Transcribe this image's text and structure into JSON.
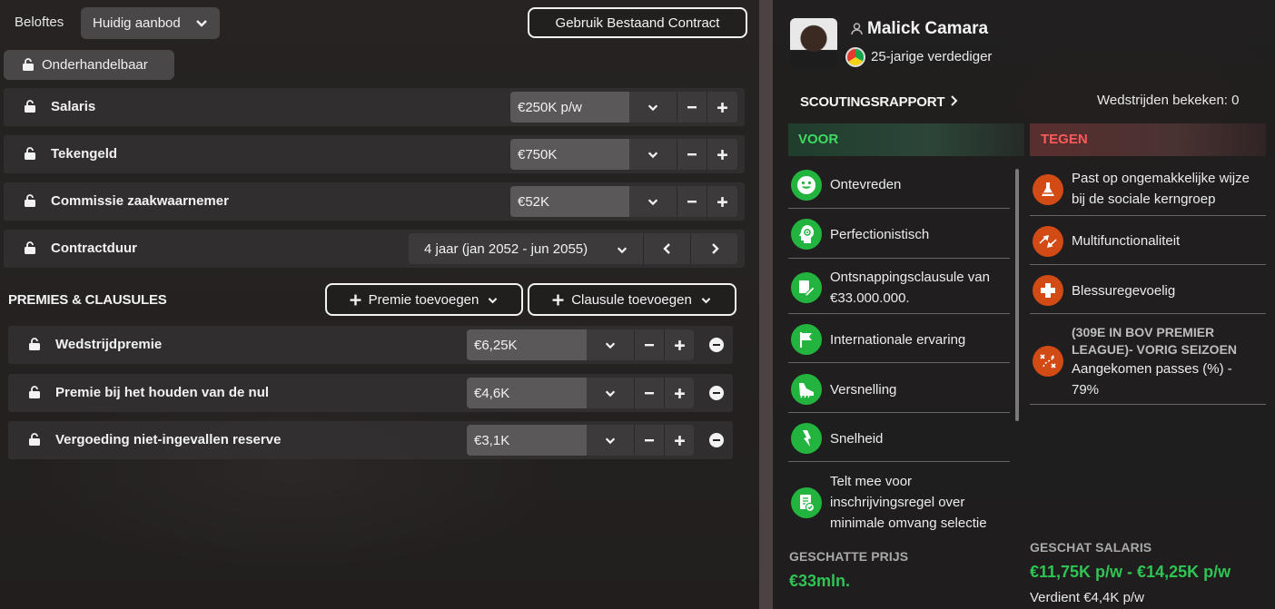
{
  "top": {
    "beloftes_label": "Beloftes",
    "offer_dropdown": "Huidig aanbod",
    "use_contract_button": "Gebruik Bestaand Contract",
    "negotiable_button": "Onderhandelbaar"
  },
  "terms": [
    {
      "label": "Salaris",
      "value": "€250K p/w"
    },
    {
      "label": "Tekengeld",
      "value": "€750K"
    },
    {
      "label": "Commissie zaakwaarnemer",
      "value": "€52K"
    },
    {
      "label": "Contractduur",
      "value": "4 jaar (jan 2052 - jun 2055)"
    }
  ],
  "bonuses": {
    "title": "PREMIES & CLAUSULES",
    "add_bonus": "Premie toevoegen",
    "add_clause": "Clausule toevoegen",
    "items": [
      {
        "label": "Wedstrijdpremie",
        "value": "€6,25K"
      },
      {
        "label": "Premie bij het houden van de nul",
        "value": "€4,6K"
      },
      {
        "label": "Vergoeding niet-ingevallen reserve",
        "value": "€3,1K"
      }
    ]
  },
  "player": {
    "name": "Malick Camara",
    "description": "25-jarige verdediger"
  },
  "scouting": {
    "link": "SCOUTINGSRAPPORT",
    "matches_seen": "Wedstrijden bekeken: 0",
    "pro_title": "VOOR",
    "con_title": "TEGEN",
    "pros": [
      {
        "icon": "smiley-icon",
        "lines": [
          "Ontevreden"
        ]
      },
      {
        "icon": "head-target-icon",
        "lines": [
          "Perfectionistisch"
        ]
      },
      {
        "icon": "contract-pen-icon",
        "lines": [
          "Ontsnappingsclausule van",
          "€33.000.000."
        ]
      },
      {
        "icon": "flag-icon",
        "lines": [
          "Internationale ervaring"
        ]
      },
      {
        "icon": "boot-icon",
        "lines": [
          "Versnelling"
        ]
      },
      {
        "icon": "lightning-icon",
        "lines": [
          "Snelheid"
        ]
      },
      {
        "icon": "checklist-icon",
        "lines": [
          "Telt mee voor",
          "inschrijvingsregel over",
          "minimale omvang selectie"
        ]
      }
    ],
    "cons": [
      {
        "icon": "flask-icon",
        "lines": [
          "Past op ongemakkelijke wijze",
          "bij de sociale kerngroep"
        ]
      },
      {
        "icon": "swap-arrows-icon",
        "lines": [
          "Multifunctionaliteit"
        ]
      },
      {
        "icon": "medical-cross-icon",
        "lines": [
          "Blessuregevoelig"
        ]
      },
      {
        "icon": "tactics-icon",
        "heading": [
          "(309E IN BOV PREMIER",
          "LEAGUE)- VORIG SEIZOEN"
        ],
        "lines": [
          "Aangekomen passes (%) -",
          "79%"
        ]
      }
    ]
  },
  "estimates": {
    "price_label": "GESCHATTE PRIJS",
    "price_value": "€33mln.",
    "salary_label": "GESCHAT SALARIS",
    "salary_value": "€11,75K p/w - €14,25K p/w",
    "earns": "Verdient €4,4K p/w"
  },
  "colors": {
    "pro_green": "#2fc454",
    "con_red": "#ff5a5a",
    "pro_icon": "#22b43e",
    "con_icon": "#d24b14"
  }
}
